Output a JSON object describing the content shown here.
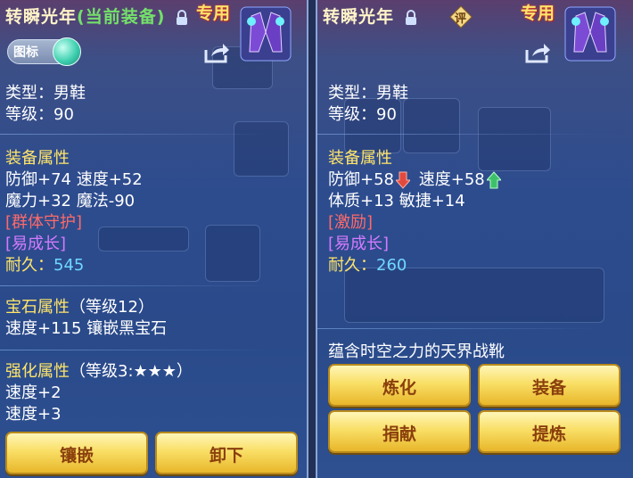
{
  "left_panel": {
    "title": "转瞬光年",
    "title_status": "(当前装备)",
    "special_tag": "专用",
    "icon_toggle_label": "图标",
    "type_line": "类型：男鞋",
    "level_line": "等级：90",
    "equip_attr_header": "装备属性",
    "attr_line_1": "防御+74 速度+52",
    "attr_line_2": "魔力+32 魔法-90",
    "effect_1": "[群体守护]",
    "effect_2": "[易成长]",
    "durability_label": "耐久：",
    "durability_value": "545",
    "gem_attr_header": "宝石属性",
    "gem_level": "（等级12）",
    "gem_line": "速度+115 镶嵌黑宝石",
    "enhance_header": "强化属性",
    "enhance_level": "（等级3:★★★）",
    "enhance_line_1": "速度+2",
    "enhance_line_2": "速度+3",
    "buttons": {
      "inlay": "镶嵌",
      "unequip": "卸下"
    }
  },
  "right_panel": {
    "title": "转瞬光年",
    "review_badge": "评",
    "special_tag": "专用",
    "type_line": "类型：男鞋",
    "level_line": "等级：90",
    "equip_attr_header": "装备属性",
    "defense": "防御+58",
    "speed": "速度+58",
    "attr_line_2": "体质+13 敏捷+14",
    "effect_1": "[激励]",
    "effect_2": "[易成长]",
    "durability_label": "耐久：",
    "durability_value": "260",
    "description": "蕴含时空之力的天界战靴",
    "buttons": {
      "refine": "炼化",
      "equip": "装备",
      "donate": "捐献",
      "extract": "提炼"
    }
  },
  "colors": {
    "title": "#fff4c8",
    "current": "#74e06a",
    "header": "#ffe56a",
    "value": "#5fdcff",
    "effect_red": "#ff6a6a",
    "effect_purple": "#d47aff",
    "button_text": "#8a3f0c"
  }
}
